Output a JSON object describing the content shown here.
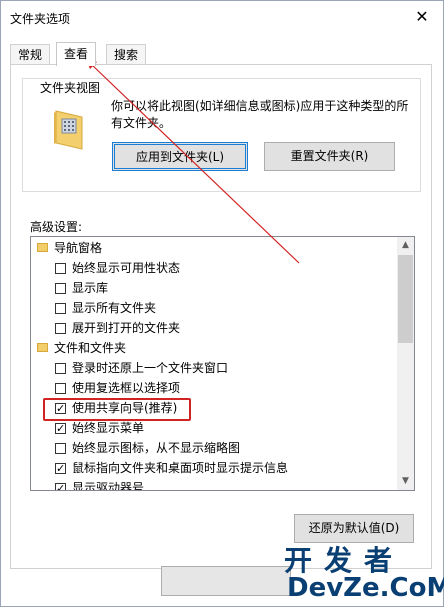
{
  "window": {
    "title": "文件夹选项",
    "close_icon": "close-icon"
  },
  "tabs": [
    {
      "label": "常规"
    },
    {
      "label": "查看"
    },
    {
      "label": "搜索"
    }
  ],
  "folder_views": {
    "title": "文件夹视图",
    "description": "你可以将此视图(如详细信息或图标)应用于这种类型的所有文件夹。",
    "apply_button": "应用到文件夹(L)",
    "reset_button": "重置文件夹(R)"
  },
  "advanced": {
    "label": "高级设置:",
    "items": [
      {
        "type": "folder",
        "label": "导航窗格"
      },
      {
        "type": "check",
        "checked": false,
        "label": "始终显示可用性状态"
      },
      {
        "type": "check",
        "checked": false,
        "label": "显示库"
      },
      {
        "type": "check",
        "checked": false,
        "label": "显示所有文件夹"
      },
      {
        "type": "check",
        "checked": false,
        "label": "展开到打开的文件夹"
      },
      {
        "type": "folder",
        "label": "文件和文件夹"
      },
      {
        "type": "check",
        "checked": false,
        "label": "登录时还原上一个文件夹窗口"
      },
      {
        "type": "check",
        "checked": false,
        "label": "使用复选框以选择项"
      },
      {
        "type": "check",
        "checked": true,
        "label": "使用共享向导(推荐)"
      },
      {
        "type": "check",
        "checked": true,
        "label": "始终显示菜单"
      },
      {
        "type": "check",
        "checked": false,
        "label": "始终显示图标，从不显示缩略图"
      },
      {
        "type": "check",
        "checked": true,
        "label": "鼠标指向文件夹和桌面项时显示提示信息"
      },
      {
        "type": "check",
        "checked": true,
        "label": "显示驱动器号"
      }
    ],
    "restore_button": "还原为默认值(D)"
  },
  "watermark": {
    "line1": "开发者",
    "line2": "DevZe.CoM"
  },
  "colors": {
    "annotation_red": "#d22323",
    "accent_blue": "#1a7fd4"
  }
}
